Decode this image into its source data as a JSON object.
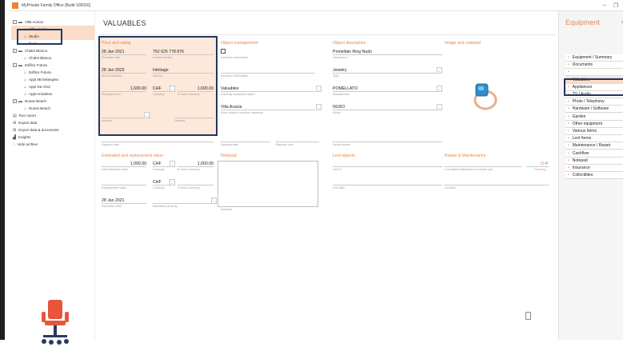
{
  "window": {
    "title": "MyPrivate Family Office [Build 100016]"
  },
  "tree": [
    {
      "label": "Villa Acacia",
      "level": 0,
      "icon": "folder-icon",
      "toggle": "−"
    },
    {
      "label": "Villa Acacia",
      "level": 1,
      "icon": "house-icon",
      "selected": true
    },
    {
      "label": "Studio",
      "level": 1,
      "icon": "house-icon",
      "selected": true
    },
    {
      "label": "Pool",
      "level": 1,
      "icon": "house-icon"
    },
    {
      "label": "Chalet Blanca",
      "level": 0,
      "icon": "folder-icon",
      "toggle": "−"
    },
    {
      "label": "Chalet Blanca",
      "level": 1,
      "icon": "house-icon"
    },
    {
      "label": "Edifice Futura",
      "level": 0,
      "icon": "folder-icon",
      "toggle": "−"
    },
    {
      "label": "Edifice Futura",
      "level": 1,
      "icon": "house-icon"
    },
    {
      "label": "Appt Michelangelo",
      "level": 1,
      "icon": "house-icon"
    },
    {
      "label": "Appt Da Vinci",
      "level": 1,
      "icon": "house-icon"
    },
    {
      "label": "Appt Amadeus",
      "level": 1,
      "icon": "house-icon"
    },
    {
      "label": "Dunas Beach",
      "level": 0,
      "icon": "folder-icon",
      "toggle": "−"
    },
    {
      "label": "Dunas Beach",
      "level": 1,
      "icon": "house-icon"
    },
    {
      "label": "Run report",
      "level": 0,
      "icon": "report-icon"
    },
    {
      "label": "Export data",
      "level": 0,
      "icon": "export-icon"
    },
    {
      "label": "Export data & documents",
      "level": 0,
      "icon": "export-icon"
    },
    {
      "label": "Insights",
      "level": 0,
      "icon": "chart-icon"
    },
    {
      "label": "Hide archive",
      "level": 0,
      "icon": "eye-off-icon"
    }
  ],
  "main": {
    "title": "VALUABLES",
    "price": {
      "heading": "Price and rating",
      "purchase_date": "28 Jan 2021",
      "purchase_date_cap": "Purchase date",
      "invoice_number": "762 625 778 876",
      "invoice_number_cap": "Invoice number",
      "end_warranty": "28 Jan 2023",
      "end_warranty_cap": "End of warranty",
      "sold_by": "Héritage",
      "sold_by_cap": "Sold by",
      "purchase_price": "1,600.00",
      "purchase_price_cap": "Purchase price",
      "currency": "CHF",
      "currency_cap": "Currency",
      "home_currency_val": "1,600.00",
      "home_currency_cap": "In home currency",
      "account_cap": "Account",
      "detailed_cap": "Detailed"
    },
    "object_management": {
      "heading": "Object management",
      "include_succession_cap": "Include in succession",
      "include_collectibles_cap": "Include in collectibles",
      "household_object": "Valuables",
      "household_object_cap": "Indirectly household object",
      "residence": "Villa Acacia",
      "residence_cap": "Move object to another residence",
      "disposal_date_cap": "Disposal date",
      "disposal_note_cap": "Disposal note"
    },
    "object_description": {
      "heading": "Object description",
      "description": "Pomellato Ring Nudo",
      "description_cap": "Description *",
      "type": "Jewelry",
      "type_cap": "Type",
      "manufacturer": "POMELLATO",
      "manufacturer_cap": "Manufacturer",
      "model": "NUDO",
      "model_cap": "Model",
      "serial_cap": "Serial number"
    },
    "image_notepad": {
      "heading": "Image and notepad"
    },
    "payment_date_cap": "Payment date",
    "estimated": {
      "heading": "Estimated and replacement value",
      "last_value": "1,000.00",
      "last_value_cap": "Last estimated value",
      "currency": "CHF",
      "currency_cap": "Currency",
      "home_value": "1,000.00",
      "home_value_cap": "In home currency",
      "repl_currency": "CHF",
      "repl_value_cap": "Replacement value",
      "repl_currency_cap": "Currency",
      "repl_home_cap": "In home currency",
      "estimation_date": "28 Jan 2021",
      "estimation_date_cap": "Estimation date",
      "estimation_by_cap": "Estimation done by"
    },
    "notepad": {
      "heading": "Notepad",
      "cap": "Notepad"
    },
    "lent": {
      "heading": "Lent objects",
      "lent_to_cap": "Lent to",
      "lent_date_cap": "Lent date"
    },
    "repair": {
      "heading": "Repair & Maintenance",
      "currency": "CHF",
      "cost_cap": "Cumulated maintenance & repair cost",
      "currency_cap": "Currency",
      "location_cap": "Location"
    }
  },
  "equipment": {
    "title": "Equipment",
    "items": [
      "Equipment / Summary",
      "Documents",
      "",
      "Valuables",
      "Appliances",
      "TV / Audio",
      "Photo / Telephony",
      "Hardware / Software",
      "Garden",
      "Other equipment",
      "Various Items",
      "Lent Items",
      "Maintenance / Repair",
      "Cashflow",
      "Notepad",
      "Insurance",
      "Collectibles"
    ],
    "active_index": 3
  },
  "colors": {
    "accent": "#e6874f",
    "highlight": "#fbdcc8",
    "frame": "#24365e"
  }
}
